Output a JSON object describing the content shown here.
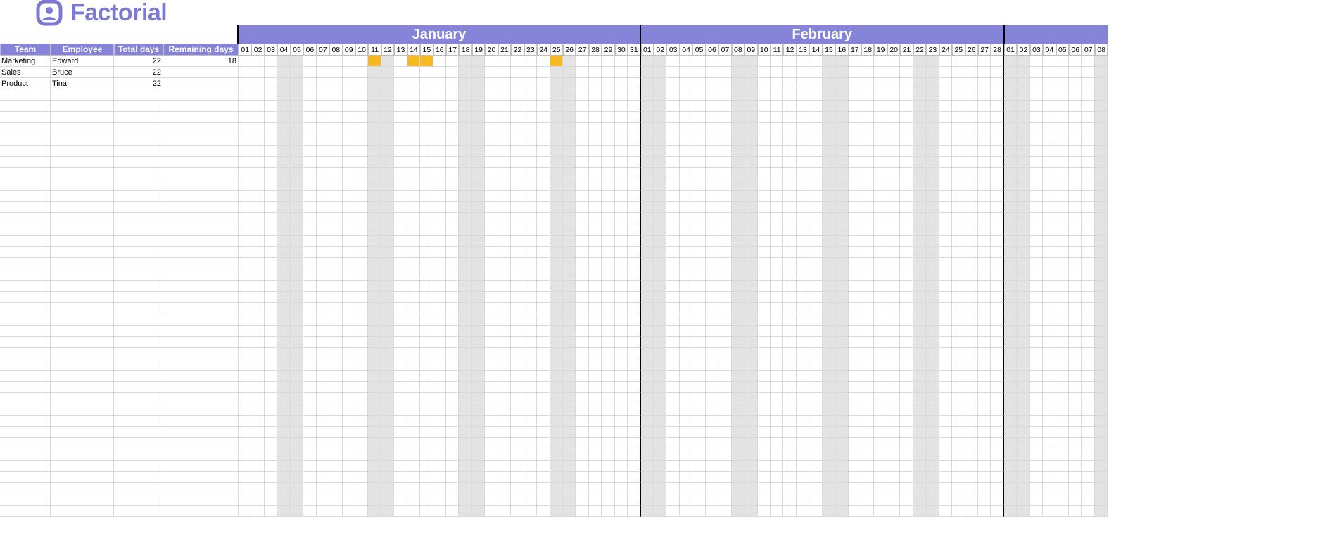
{
  "brand": {
    "name": "Factorial"
  },
  "colors": {
    "accent": "#8684d8",
    "weekend": "#e3e3e3",
    "off": "#f6b921"
  },
  "columns": {
    "team": "Team",
    "employee": "Employee",
    "total": "Total days",
    "remaining": "Remaining days"
  },
  "months": [
    {
      "name": "January",
      "days": 31,
      "weekend": [
        4,
        5,
        11,
        12,
        18,
        19,
        25,
        26
      ],
      "partial": false
    },
    {
      "name": "February",
      "days": 28,
      "weekend": [
        1,
        2,
        8,
        9,
        15,
        16,
        22,
        23
      ],
      "partial": false
    },
    {
      "name": "",
      "days": 8,
      "weekend": [
        1,
        2,
        8
      ],
      "partial": true
    }
  ],
  "employees": [
    {
      "team": "Marketing",
      "name": "Edward",
      "total": 22,
      "remaining": 18,
      "off": {
        "January": [
          11,
          14,
          15,
          25
        ]
      }
    },
    {
      "team": "Sales",
      "name": "Bruce",
      "total": 22,
      "remaining": "",
      "off": {}
    },
    {
      "team": "Product",
      "name": "Tina",
      "total": 22,
      "remaining": "",
      "off": {}
    }
  ],
  "empty_rows": 38
}
